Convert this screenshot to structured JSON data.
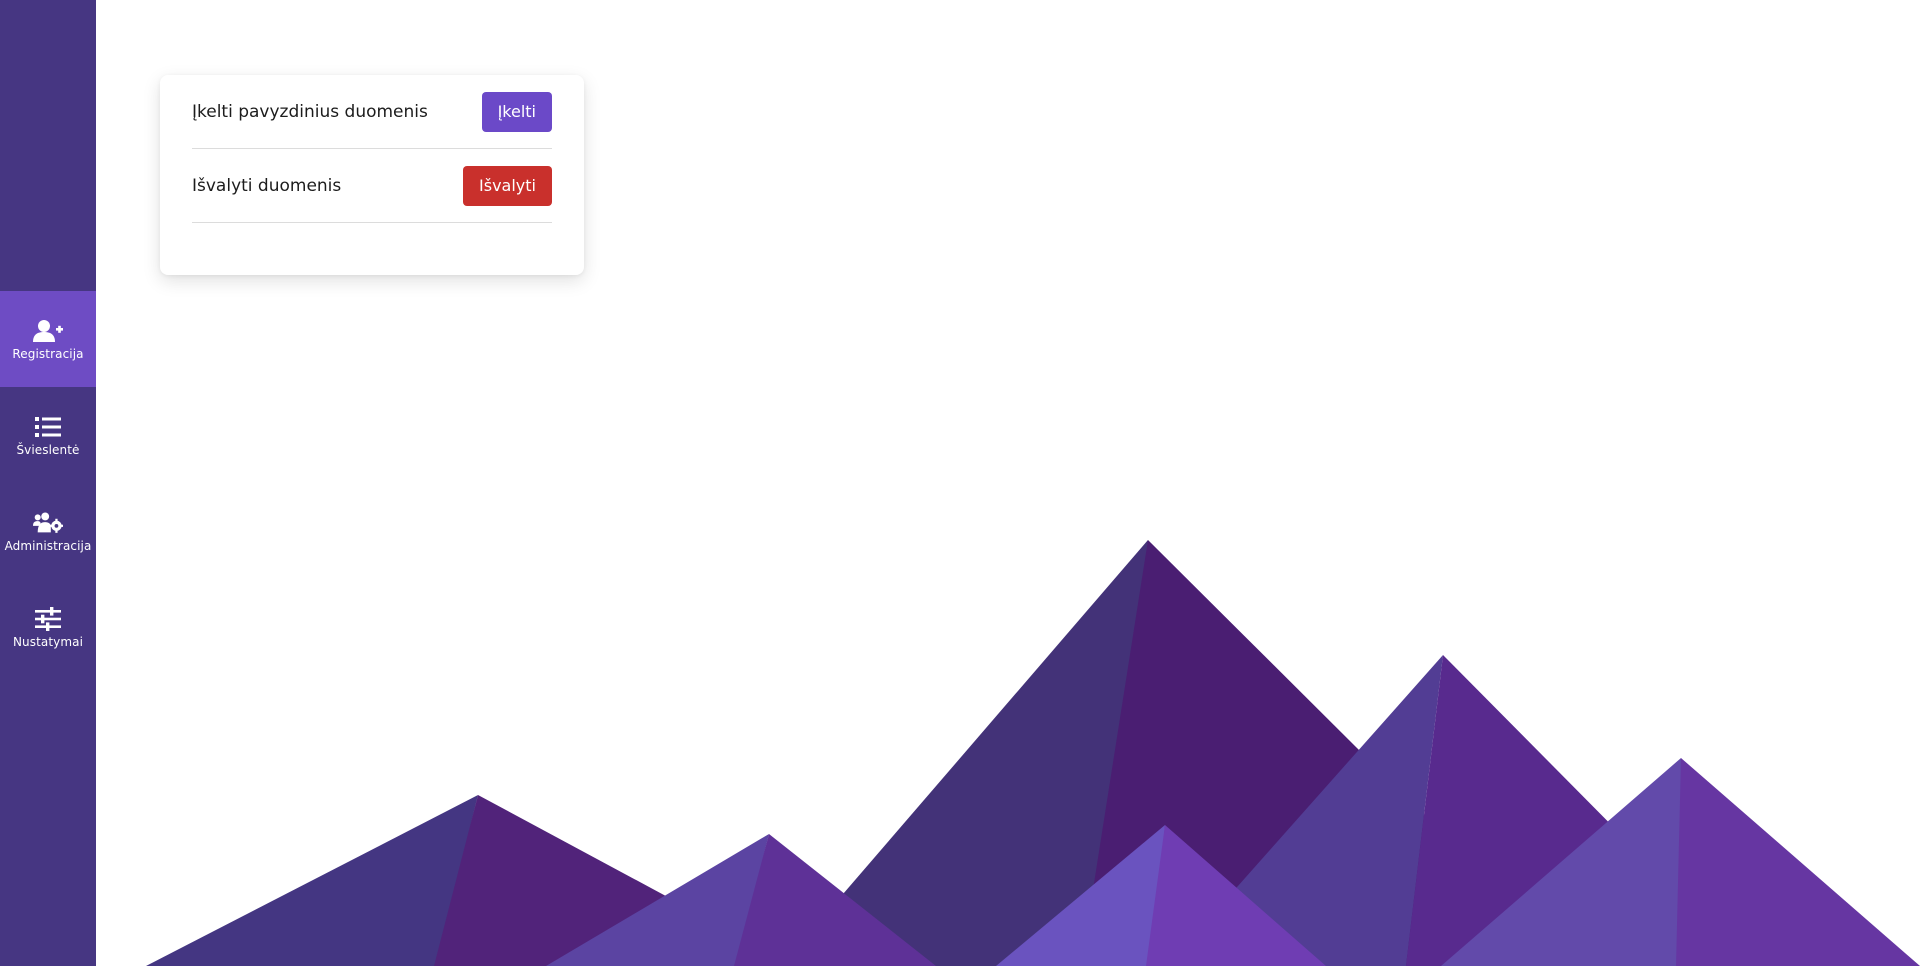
{
  "sidebar": {
    "background": "#463682",
    "active_background": "#6e4cc4",
    "items": [
      {
        "label": "Registracija",
        "icon": "user-plus-icon",
        "active": true
      },
      {
        "label": "Švieslentė",
        "icon": "list-icon",
        "active": false
      },
      {
        "label": "Administracija",
        "icon": "users-cog-icon",
        "active": false
      },
      {
        "label": "Nustatymai",
        "icon": "sliders-icon",
        "active": false
      }
    ]
  },
  "card": {
    "rows": [
      {
        "label": "Įkelti pavyzdinius duomenis",
        "button": "Įkelti",
        "button_color": "#6b49c8"
      },
      {
        "label": "Išvalyti duomenis",
        "button": "Išvalyti",
        "button_color": "#c9302c"
      }
    ]
  }
}
